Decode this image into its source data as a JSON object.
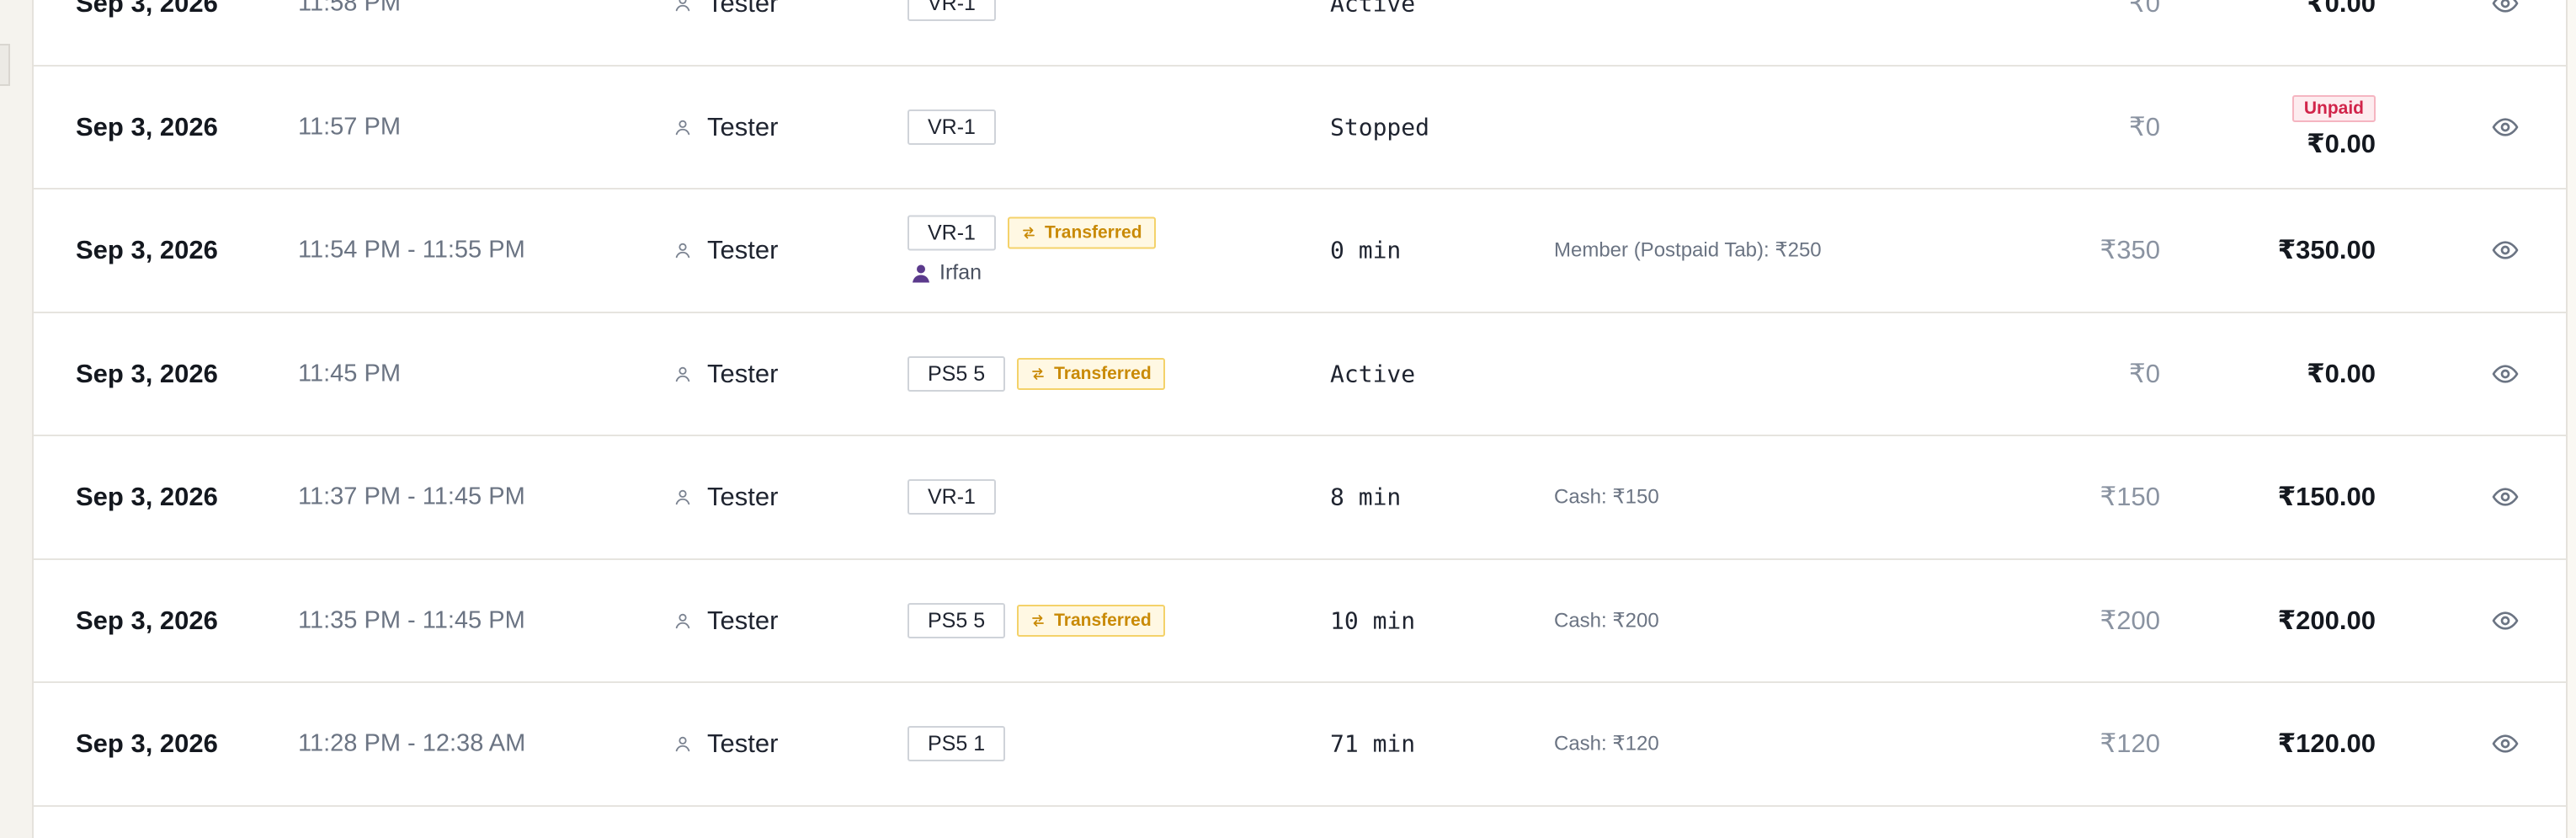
{
  "rows": [
    {
      "date": "Sep 3, 2026",
      "time": "11:58 PM",
      "user": "Tester",
      "device": "VR-1",
      "transferred": "",
      "member": "",
      "duration": "Active",
      "payment": "",
      "amount": "₹0",
      "unpaid": "",
      "total": "₹0.00"
    },
    {
      "date": "Sep 3, 2026",
      "time": "11:57 PM",
      "user": "Tester",
      "device": "VR-1",
      "transferred": "",
      "member": "",
      "duration": "Stopped",
      "payment": "",
      "amount": "₹0",
      "unpaid": "Unpaid",
      "total": "₹0.00"
    },
    {
      "date": "Sep 3, 2026",
      "time": "11:54 PM - 11:55 PM",
      "user": "Tester",
      "device": "VR-1",
      "transferred": "Transferred",
      "member": "Irfan",
      "duration": "0 min",
      "payment": "Member (Postpaid Tab): ₹250",
      "amount": "₹350",
      "unpaid": "",
      "total": "₹350.00"
    },
    {
      "date": "Sep 3, 2026",
      "time": "11:45 PM",
      "user": "Tester",
      "device": "PS5 5",
      "transferred": "Transferred",
      "member": "",
      "duration": "Active",
      "payment": "",
      "amount": "₹0",
      "unpaid": "",
      "total": "₹0.00"
    },
    {
      "date": "Sep 3, 2026",
      "time": "11:37 PM - 11:45 PM",
      "user": "Tester",
      "device": "VR-1",
      "transferred": "",
      "member": "",
      "duration": "8 min",
      "payment": "Cash: ₹150",
      "amount": "₹150",
      "unpaid": "",
      "total": "₹150.00"
    },
    {
      "date": "Sep 3, 2026",
      "time": "11:35 PM - 11:45 PM",
      "user": "Tester",
      "device": "PS5 5",
      "transferred": "Transferred",
      "member": "",
      "duration": "10 min",
      "payment": "Cash: ₹200",
      "amount": "₹200",
      "unpaid": "",
      "total": "₹200.00"
    },
    {
      "date": "Sep 3, 2026",
      "time": "11:28 PM - 12:38 AM",
      "user": "Tester",
      "device": "PS5 1",
      "transferred": "",
      "member": "",
      "duration": "71 min",
      "payment": "Cash: ₹120",
      "amount": "₹120",
      "unpaid": "",
      "total": "₹120.00"
    }
  ],
  "icons": {
    "user": "user-icon",
    "transfer": "transfer-arrows-icon",
    "member": "member-person-icon",
    "view": "eye-icon"
  },
  "colors": {
    "transfer_text": "#c98a06",
    "transfer_bg": "#fff8e3",
    "unpaid_text": "#d1244a",
    "member_icon": "#5b3a8c"
  }
}
